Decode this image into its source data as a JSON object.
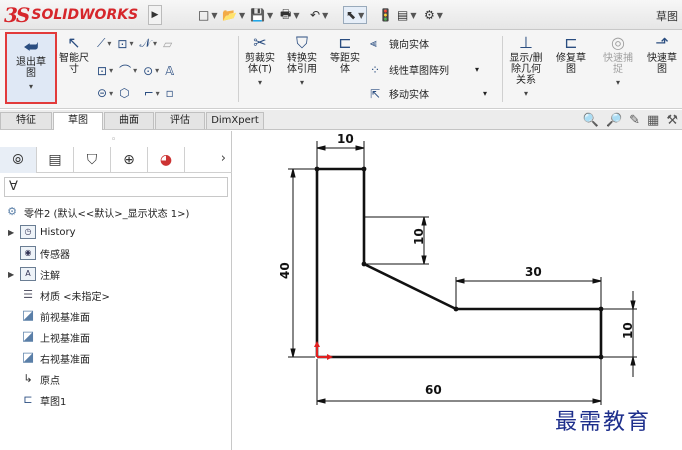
{
  "app": {
    "logo_ds": "3S",
    "logo_text": "SOLIDWORKS",
    "title_right": "草图"
  },
  "quick_access": {
    "new": "□",
    "open": "📂",
    "save": "💾",
    "print": "🖶",
    "undo": "↶",
    "select": "⬉",
    "rebuild": "🚦",
    "file_props": "▤",
    "options": "⚙"
  },
  "command_manager": {
    "exit_sketch": "退出草\n图",
    "smart_dimension": "智能尺\n寸",
    "trim": "剪裁实\n体(T)",
    "convert": "转换实\n体引用",
    "offset": "等距实\n体",
    "mirror": "镜向实体",
    "linear_pattern": "线性草图阵列",
    "move": "移动实体",
    "display_delete": "显示/删\n除几何\n关系",
    "repair": "修复草\n图",
    "quick_snaps": "快速捕\n捉",
    "rapid_sketch": "快速草\n图"
  },
  "tabs": [
    {
      "label": "特征"
    },
    {
      "label": "草图"
    },
    {
      "label": "曲面"
    },
    {
      "label": "评估"
    },
    {
      "label": "DimXpert"
    }
  ],
  "tree": {
    "part": "零件2 (默认<<默认>_显示状态 1>)",
    "history": "History",
    "sensors": "传感器",
    "annotations": "注解",
    "material": "材质 <未指定>",
    "front_plane": "前视基准面",
    "top_plane": "上视基准面",
    "right_plane": "右视基准面",
    "origin": "原点",
    "sketch": "草图1"
  },
  "dimensions": {
    "d_top": "10",
    "d_step": "10",
    "d_left": "40",
    "d_mid": "30",
    "d_right": "10",
    "d_bottom": "60"
  },
  "watermark": "最需教育",
  "colors": {
    "accent": "#2a4d80",
    "highlight": "#e23a3a",
    "origin": "#e02020",
    "watermark": "#1e2f8c"
  }
}
